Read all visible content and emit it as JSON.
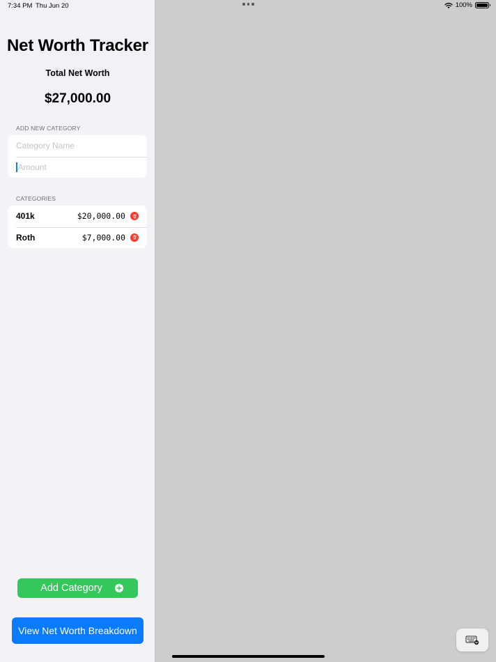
{
  "status_bar": {
    "time": "7:34 PM",
    "date": "Thu Jun 20",
    "battery": "100%"
  },
  "header": {
    "title": "Net Worth Tracker",
    "total_label": "Total Net Worth",
    "total_value": "$27,000.00"
  },
  "add_section": {
    "header": "ADD NEW CATEGORY",
    "name_placeholder": "Category Name",
    "amount_placeholder": "Amount"
  },
  "categories_section": {
    "header": "CATEGORIES",
    "items": [
      {
        "name": "401k",
        "amount": "$20,000.00"
      },
      {
        "name": "Roth",
        "amount": "$7,000.00"
      }
    ]
  },
  "buttons": {
    "add_category": "Add Category",
    "view_breakdown": "View Net Worth Breakdown"
  },
  "colors": {
    "green": "#34c759",
    "blue": "#0a7aff",
    "red": "#ff3b30"
  },
  "icons": {
    "add": "plus-circle-icon",
    "delete": "trash-icon",
    "keyboard": "keyboard-dismiss-icon",
    "wifi": "wifi-icon",
    "battery": "battery-icon"
  }
}
